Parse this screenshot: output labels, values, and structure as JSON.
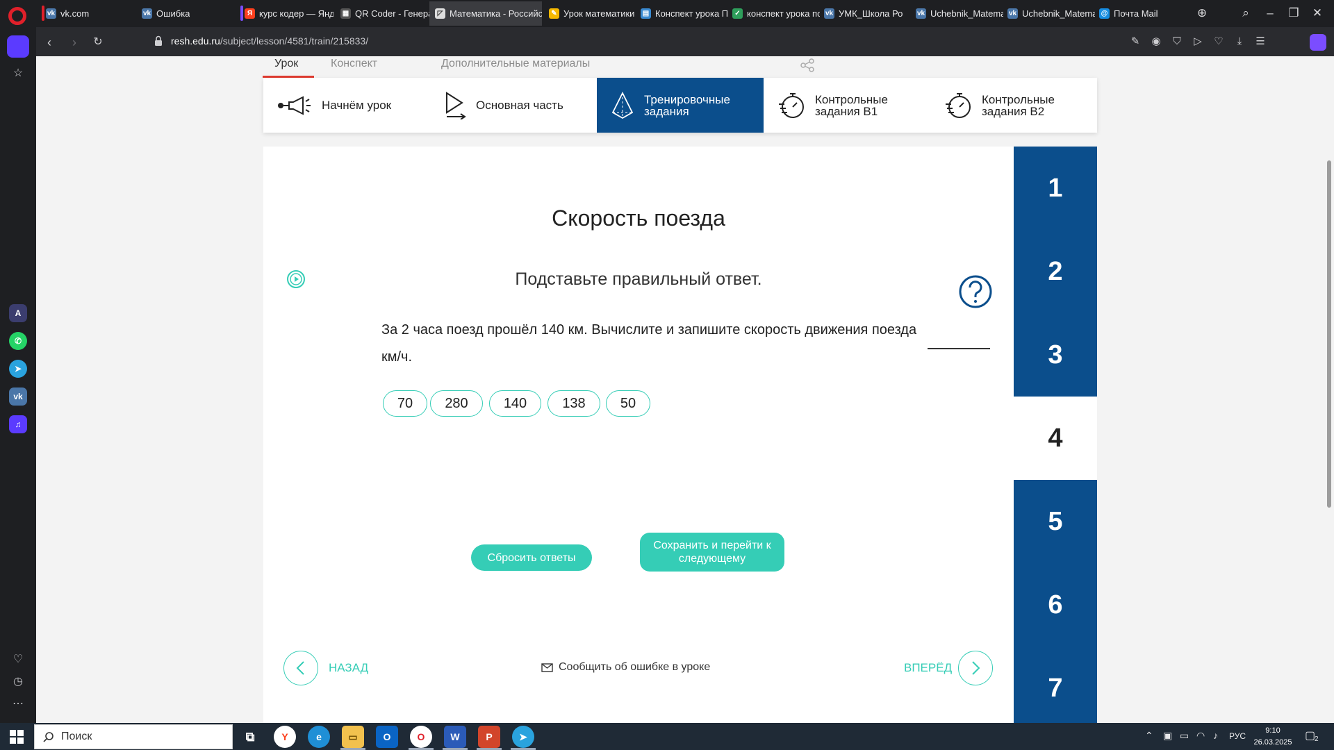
{
  "browser": {
    "tabs": [
      {
        "label": "vk.com",
        "color": "#4a76a8",
        "letter": "vk"
      },
      {
        "label": "Ошибка",
        "color": "#4a76a8",
        "letter": "vk"
      },
      {
        "label": "курс кодер — Яндекс",
        "color": "#fc3f1d",
        "letter": "Я"
      },
      {
        "label": "QR Coder - Генерато",
        "color": "#333333",
        "letter": "QR"
      },
      {
        "label": "Математика - Российская",
        "color": "#dddddd",
        "letter": "М"
      },
      {
        "label": "Урок математики в",
        "color": "#f5b800",
        "letter": "У"
      },
      {
        "label": "Конспект урока Пр",
        "color": "#3a8ad1",
        "letter": "К"
      },
      {
        "label": "конспект урока по",
        "color": "#2e9e5b",
        "letter": "✓"
      },
      {
        "label": "УМК_Школа Ро",
        "color": "#4a76a8",
        "letter": "vk"
      },
      {
        "label": "Uchebnik_Matemat",
        "color": "#4a76a8",
        "letter": "vk"
      },
      {
        "label": "Uchebnik_Matemat",
        "color": "#4a76a8",
        "letter": "vk"
      },
      {
        "label": "Почта Mail",
        "color": "#168de2",
        "letter": "@"
      }
    ],
    "url_host": "resh.edu.ru",
    "url_path": "/subject/lesson/4581/train/215833/"
  },
  "subnav": {
    "items": [
      "Урок",
      "Конспект",
      "Дополнительные материалы"
    ]
  },
  "steps": [
    {
      "label": "Начнём урок"
    },
    {
      "label": "Основная часть"
    },
    {
      "label": "Тренировочные задания"
    },
    {
      "label": "Контрольные задания В1"
    },
    {
      "label": "Контрольные задания В2"
    }
  ],
  "task": {
    "title": "Скорость поезда",
    "instruction": "Подставьте правильный ответ.",
    "question_line1": "За 2 часа поезд прошёл 140 км. Вычислите и запишите скорость движения поезда",
    "question_line2": "км/ч.",
    "options": [
      "70",
      "280",
      "140",
      "138",
      "50"
    ],
    "reset_label": "Сбросить ответы",
    "save_label": "Сохранить и перейти к следующему",
    "back_label": "НАЗАД",
    "forward_label": "ВПЕРЁД",
    "report_label": "Сообщить об ошибке в уроке"
  },
  "task_numbers": [
    "1",
    "2",
    "3",
    "4",
    "5",
    "6",
    "7"
  ],
  "current_task": "4",
  "taskbar": {
    "search_placeholder": "Поиск",
    "language": "РУС",
    "time": "9:10",
    "date": "26.03.2025",
    "notification_count": "2"
  },
  "colors": {
    "accent": "#35cdb6",
    "primary": "#0b4e8c",
    "browser_accent": "#5b3bff"
  }
}
